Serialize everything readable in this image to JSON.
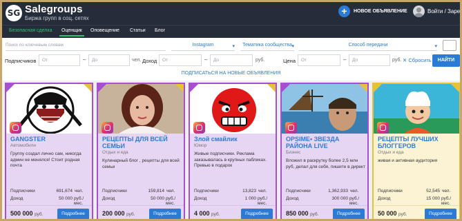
{
  "header": {
    "logo_mark": "SG",
    "site_name": "Salegroups",
    "tagline": "Биржа групп в соц. сетях",
    "new_ad_label": "НОВОЕ ОБЪЯВЛЕНИЕ",
    "login_label": "Войти / Зарегистрироваться"
  },
  "nav": {
    "items": [
      "Безопасная сделка",
      "Оценщик",
      "Оповещение",
      "Статьи",
      "Блог"
    ]
  },
  "filters": {
    "search_placeholder": "Поиск по ключевым словам",
    "platform": "Instagram",
    "theme": "Тематика сообщества",
    "transfer": "Способ передачи",
    "subscribers_label": "Подписчиков",
    "income_label": "Доход",
    "price_label": "Цена",
    "from_placeholder": "От",
    "to_placeholder": "До",
    "unit_people": "чел.",
    "unit_rub": "руб.",
    "reset_label": "Сбросить",
    "find_label": "НАЙТИ",
    "subscribe_label": "ПОДПИСАТЬСЯ НА НОВЫЕ ОБЪЯВЛЕНИЯ"
  },
  "cards": [
    {
      "title": "GANGSTER",
      "category": "Автомобили",
      "description": "Группу создал лично сам, никогда админ не менялся! Стоит родная почта",
      "subs_label": "Подписчики",
      "subs": "691,674",
      "subs_unit": "чел.",
      "income_label": "Доход",
      "income": "50 000",
      "income_unit": "руб./мес.",
      "price": "500 000",
      "price_unit": "руб.",
      "button": "Подробнее"
    },
    {
      "title": "РЕЦЕПТЫ ДЛЯ ВСЕЙ СЕМЬИ",
      "category": "Отдых и еда",
      "description": "Кулинарный блог , рецепты для всей семьи",
      "subs_label": "Подписчики",
      "subs": "159,814",
      "subs_unit": "чел.",
      "income_label": "Доход",
      "income": "50 000",
      "income_unit": "руб./мес.",
      "price": "200 000",
      "price_unit": "руб.",
      "button": "Подробнее"
    },
    {
      "title": "Злой смайлик",
      "category": "Юмор",
      "description": "Живые подписчики. Реклама заказывалась в крупных пабликах. Превью в подарок",
      "subs_label": "Подписчики",
      "subs": "13,823",
      "subs_unit": "чел.",
      "income_label": "Доход",
      "income": "1 000",
      "income_unit": "руб./мес.",
      "price": "4 000",
      "price_unit": "руб.",
      "button": "Подробнее"
    },
    {
      "title": "OPSIME• ЗВЕЗДА РАЙОНА LIVE",
      "category": "Бизнес",
      "description": "Вложил в раскрутку более 2,5 млн руб, делал для себя, пишите в директ",
      "subs_label": "Подписчики",
      "subs": "1,362,933",
      "subs_unit": "чел.",
      "income_label": "Доход",
      "income": "300 000",
      "income_unit": "руб./мес.",
      "price": "850 000",
      "price_unit": "руб.",
      "button": "Подробнее"
    },
    {
      "title": "РЕЦЕПТЫ ЛУЧШИХ БЛОГГЕРОВ",
      "category": "Отдых и еда",
      "description": "живая и активная аудитория",
      "subs_label": "Подписчики",
      "subs": "52,545",
      "subs_unit": "чел.",
      "income_label": "Доход",
      "income": "15 000",
      "income_unit": "руб./мес.",
      "price": "50 000",
      "price_unit": "руб.",
      "button": "Подробнее"
    }
  ],
  "colors": {
    "header_bg": "#262d3a",
    "accent_blue": "#2b7bd6",
    "accent_green": "#32c26c",
    "card_purple": "#a64fd0",
    "card_gold": "#e8c13a"
  }
}
